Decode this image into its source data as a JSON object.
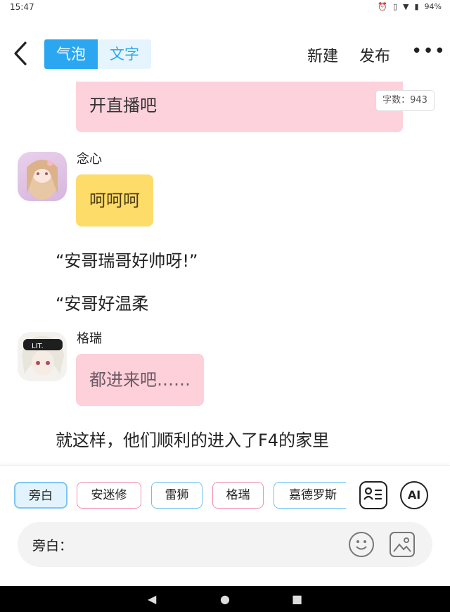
{
  "status_bar": {
    "time": "15:47",
    "battery": "94%",
    "icons": [
      "alarm-icon",
      "vibrate-icon",
      "wifi-icon",
      "battery-icon"
    ]
  },
  "header": {
    "tabs": [
      {
        "label": "气泡",
        "active": true
      },
      {
        "label": "文字",
        "active": false
      }
    ],
    "new_label": "新建",
    "publish_label": "发布",
    "more_label": "•••"
  },
  "word_count": "字数：943",
  "messages": [
    {
      "type": "bubble",
      "speaker": "",
      "text": "开直播吧",
      "color": "#fdd2dc"
    },
    {
      "type": "bubble",
      "speaker": "念心",
      "text": "呵呵呵",
      "color": "#fedc6a"
    },
    {
      "type": "narration",
      "text": "“安哥瑞哥好帅呀!”"
    },
    {
      "type": "narration",
      "text": "“安哥好温柔"
    },
    {
      "type": "bubble",
      "speaker": "格瑞",
      "text": "都进来吧……",
      "color": "#fdd0da"
    },
    {
      "type": "narration",
      "text": "就这样，他们顺利的进入了F4的家里"
    }
  ],
  "characters": [
    {
      "name": "旁白",
      "style": "selected"
    },
    {
      "name": "安迷修",
      "style": "pink"
    },
    {
      "name": "雷狮",
      "style": "blue"
    },
    {
      "name": "格瑞",
      "style": "pink"
    },
    {
      "name": "嘉德罗斯",
      "style": "blue"
    }
  ],
  "ai_label": "AI",
  "input": {
    "label": "旁白：",
    "value": ""
  },
  "colors": {
    "accent": "#2aa7f0",
    "pink_bubble": "#fdd2dc",
    "yellow_bubble": "#fedc6a"
  }
}
